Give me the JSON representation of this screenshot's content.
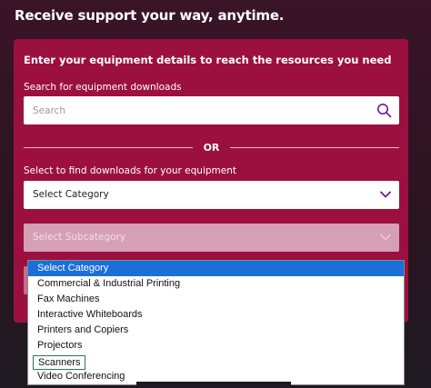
{
  "headline": "Receive support your way, anytime.",
  "card": {
    "title": "Enter your equipment details to reach the resources you need",
    "search_label": "Search for equipment downloads",
    "search_placeholder": "Search",
    "divider_text": "OR",
    "select_label": "Select to find downloads for your equipment",
    "category_value": "Select Category",
    "subcategory_value": "Select Subcategory"
  },
  "dropdown": {
    "options": [
      "Select Category",
      "Commercial & Industrial Printing",
      "Fax Machines",
      "Interactive Whiteboards",
      "Printers and Copiers",
      "Projectors",
      "Scanners",
      "Video Conferencing"
    ],
    "selected": "Select Category",
    "focused": "Scanners"
  },
  "colors": {
    "card": "#9c1040",
    "accent": "#6a1b9a",
    "highlight": "#1a6fd9"
  },
  "icons": {
    "search": "search-icon",
    "chevron": "chevron-down-icon"
  }
}
